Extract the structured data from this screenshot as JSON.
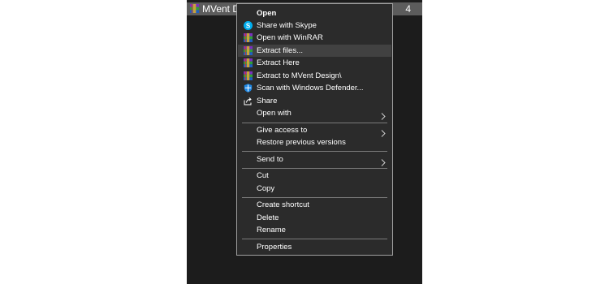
{
  "file": {
    "name": "MVent Design",
    "date_fragment": "4"
  },
  "menu": {
    "items": {
      "open": {
        "label": "Open"
      },
      "share_skype": {
        "label": "Share with Skype",
        "icon": "skype-icon"
      },
      "open_winrar": {
        "label": "Open with WinRAR",
        "icon": "winrar-icon"
      },
      "extract_files": {
        "label": "Extract files...",
        "icon": "winrar-icon"
      },
      "extract_here": {
        "label": "Extract Here",
        "icon": "winrar-icon"
      },
      "extract_to": {
        "label": "Extract to MVent Design\\",
        "icon": "winrar-icon"
      },
      "scan_defender": {
        "label": "Scan with Windows Defender...",
        "icon": "defender-icon"
      },
      "share": {
        "label": "Share",
        "icon": "share-icon"
      },
      "open_with": {
        "label": "Open with"
      },
      "give_access": {
        "label": "Give access to"
      },
      "restore": {
        "label": "Restore previous versions"
      },
      "send_to": {
        "label": "Send to"
      },
      "cut": {
        "label": "Cut"
      },
      "copy": {
        "label": "Copy"
      },
      "create_shortcut": {
        "label": "Create shortcut"
      },
      "delete": {
        "label": "Delete"
      },
      "rename": {
        "label": "Rename"
      },
      "properties": {
        "label": "Properties"
      }
    },
    "highlighted": "extract_files"
  },
  "colors": {
    "menu_bg": "#2b2b2b",
    "menu_border": "#a0a0a0",
    "highlight": "#414141",
    "separator": "#7a7a7a",
    "skype_blue": "#00aff0",
    "defender_blue": "#1e88e5"
  }
}
